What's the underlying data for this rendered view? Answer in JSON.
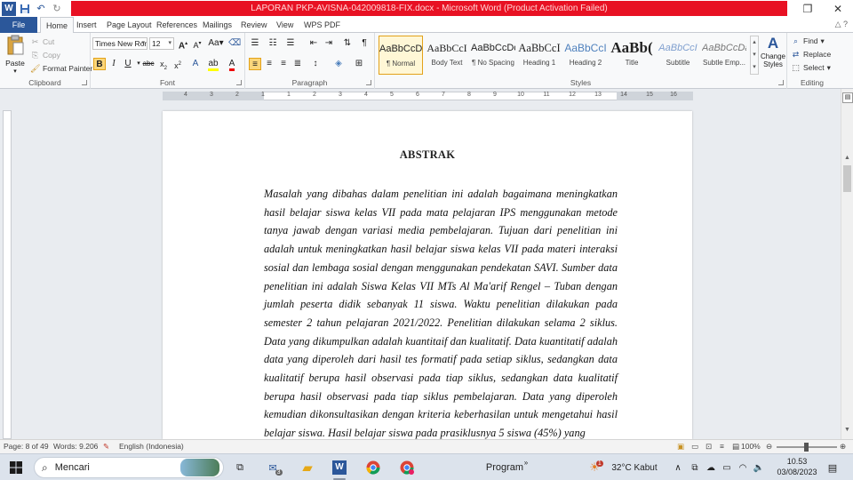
{
  "window": {
    "title": "LAPORAN PKP-AVISNA-042009818-FIX.docx - Microsoft Word (Product Activation Failed)"
  },
  "tabs": [
    "File",
    "Home",
    "Insert",
    "Page Layout",
    "References",
    "Mailings",
    "Review",
    "View",
    "WPS PDF"
  ],
  "active_tab": "Home",
  "ribbon": {
    "clipboard": {
      "label": "Clipboard",
      "paste": "Paste",
      "cut": "Cut",
      "copy": "Copy",
      "format_painter": "Format Painter"
    },
    "font": {
      "label": "Font",
      "family": "Times New Ron",
      "size": "12"
    },
    "paragraph": {
      "label": "Paragraph"
    },
    "styles": {
      "label": "Styles",
      "items": [
        {
          "sample": "AaBbCcDc",
          "name": "¶ Normal"
        },
        {
          "sample": "AaBbCcI",
          "name": "Body Text"
        },
        {
          "sample": "AaBbCcDc",
          "name": "¶ No Spacing"
        },
        {
          "sample": "AaBbCcI",
          "name": "Heading 1"
        },
        {
          "sample": "AaBbCcI",
          "name": "Heading 2"
        },
        {
          "sample": "AaBb(",
          "name": "Title"
        },
        {
          "sample": "AaBbCcI",
          "name": "Subtitle"
        },
        {
          "sample": "AaBbCcDa",
          "name": "Subtle Emp..."
        }
      ],
      "change_styles": "Change Styles"
    },
    "editing": {
      "label": "Editing",
      "find": "Find",
      "replace": "Replace",
      "select": "Select"
    }
  },
  "ruler": {
    "numbers": [
      "4",
      "3",
      "2",
      "1",
      "1",
      "2",
      "3",
      "4",
      "5",
      "6",
      "7",
      "8",
      "9",
      "10",
      "11",
      "12",
      "13",
      "14",
      "15",
      "16"
    ]
  },
  "document": {
    "title": "ABSTRAK",
    "body": "Masalah yang dibahas dalam penelitian ini adalah bagaimana meningkatkan hasil belajar siswa kelas VII pada mata pelajaran IPS menggunakan metode tanya jawab dengan variasi media pembelajaran. Tujuan dari penelitian ini adalah untuk meningkatkan hasil belajar siswa kelas VII pada materi interaksi sosial dan lembaga sosial dengan menggunakan pendekatan SAVI. Sumber data penelitian ini adalah Siswa Kelas VII MTs Al Ma'arif Rengel – Tuban dengan jumlah peserta didik sebanyak 11 siswa. Waktu penelitian dilakukan pada semester 2 tahun pelajaran 2021/2022. Penelitian dilakukan selama 2 siklus. Data yang dikumpulkan adalah kuantitaif dan kualitatif. Data kuantitatif adalah data yang diperoleh dari hasil tes formatif pada setiap siklus, sedangkan data kualitatif berupa hasil observasi pada tiap siklus, sedangkan data kualitatif berupa hasil observasi pada tiap siklus pembelajaran. Data yang diperoleh kemudian dikonsultasikan dengan kriteria keberhasilan untuk mengetahui hasil belajar siswa. Hasil belajar siswa pada prasiklusnya 5 siswa (45%) yang"
  },
  "status": {
    "page": "Page: 8 of 49",
    "words": "Words: 9.206",
    "language": "English (Indonesia)",
    "zoom": "100%"
  },
  "taskbar": {
    "search": "Mencari",
    "mail_badge": "3",
    "program": "Program",
    "weather_badge": "1",
    "weather": "32°C  Kabut",
    "time": "10.53",
    "date": "03/08/2023"
  },
  "colors": {
    "title_bar": "#e81123",
    "file_tab": "#2b579a",
    "selected_style": "#fbd67a"
  }
}
